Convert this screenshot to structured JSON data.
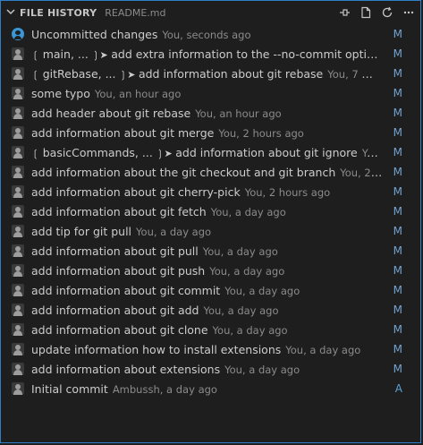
{
  "header": {
    "title": "FILE HISTORY",
    "file": "README.md",
    "icons": [
      "pin-icon",
      "open-file-icon",
      "refresh-icon",
      "ellipsis-icon"
    ]
  },
  "rows": [
    {
      "branch": "",
      "message": "Uncommitted changes",
      "meta": "You, seconds ago",
      "status": "M"
    },
    {
      "branch": "main, ...",
      "message": "add extra information to the --no-commit option...",
      "meta": "",
      "status": "M"
    },
    {
      "branch": "gitRebase, ...",
      "message": "add information about git rebase",
      "meta": "You, 7 minu...",
      "status": "M"
    },
    {
      "branch": "",
      "message": "some typo",
      "meta": "You, an hour ago",
      "status": "M"
    },
    {
      "branch": "",
      "message": "add header about git rebase",
      "meta": "You, an hour ago",
      "status": "M"
    },
    {
      "branch": "",
      "message": "add information about git merge",
      "meta": "You, 2 hours ago",
      "status": "M"
    },
    {
      "branch": "basicCommands, ...",
      "message": "add information about git ignore",
      "meta": "You, ...",
      "status": "M"
    },
    {
      "branch": "",
      "message": "add information about the git checkout and git branch",
      "meta": "You, 2 ho...",
      "status": "M"
    },
    {
      "branch": "",
      "message": "add information about git cherry-pick",
      "meta": "You, 2 hours ago",
      "status": "M"
    },
    {
      "branch": "",
      "message": "add information about git fetch",
      "meta": "You, a day ago",
      "status": "M"
    },
    {
      "branch": "",
      "message": "add tip for git pull",
      "meta": "You, a day ago",
      "status": "M"
    },
    {
      "branch": "",
      "message": "add information about git pull",
      "meta": "You, a day ago",
      "status": "M"
    },
    {
      "branch": "",
      "message": "add information about git push",
      "meta": "You, a day ago",
      "status": "M"
    },
    {
      "branch": "",
      "message": "add information about git commit",
      "meta": "You, a day ago",
      "status": "M"
    },
    {
      "branch": "",
      "message": "add information about git add",
      "meta": "You, a day ago",
      "status": "M"
    },
    {
      "branch": "",
      "message": "add information about git clone",
      "meta": "You, a day ago",
      "status": "M"
    },
    {
      "branch": "",
      "message": "update information how to install extensions",
      "meta": "You, a day ago",
      "status": "M"
    },
    {
      "branch": "",
      "message": "add information about extensions",
      "meta": "You, a day ago",
      "status": "M"
    },
    {
      "branch": "",
      "message": "Initial commit",
      "meta": "Ambussh, a day ago",
      "status": "A"
    }
  ],
  "colors": {
    "accent": "#2f7fc7",
    "status_modified": "#73a3d1",
    "uncommitted_avatar": "#3a97d6"
  }
}
